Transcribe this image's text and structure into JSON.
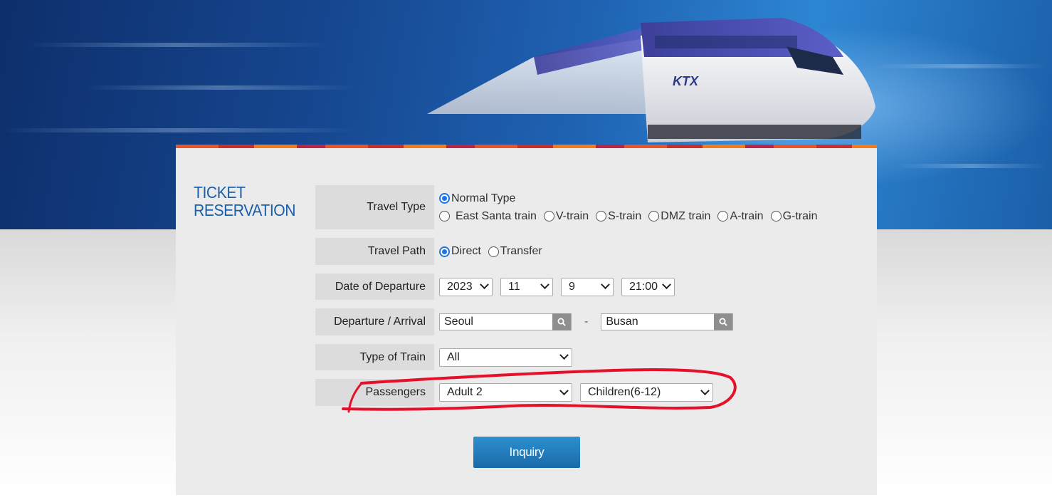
{
  "colors": {
    "accent_blue": "#1a5fa9",
    "button_blue": "#1a6aa8",
    "panel_bg": "#ebebeb",
    "label_bg": "#dcdcdc",
    "stripe_orange": "#e8552a",
    "annotation_red": "#e5102a"
  },
  "hero": {
    "train_logo": "KTX"
  },
  "section": {
    "title_line1": "TICKET",
    "title_line2": "RESERVATION"
  },
  "travel_type": {
    "label": "Travel Type",
    "options": [
      {
        "label": "Normal Type",
        "checked": true
      },
      {
        "label": "East Santa train",
        "checked": false
      },
      {
        "label": "V-train",
        "checked": false
      },
      {
        "label": "S-train",
        "checked": false
      },
      {
        "label": "DMZ train",
        "checked": false
      },
      {
        "label": "A-train",
        "checked": false
      },
      {
        "label": "G-train",
        "checked": false
      }
    ]
  },
  "travel_path": {
    "label": "Travel Path",
    "options": [
      {
        "label": "Direct",
        "checked": true
      },
      {
        "label": "Transfer",
        "checked": false
      }
    ]
  },
  "date": {
    "label": "Date of Departure",
    "year": "2023",
    "month": "11",
    "day": "9",
    "time": "21:00"
  },
  "route": {
    "label": "Departure / Arrival",
    "departure": "Seoul",
    "separator": "-",
    "arrival": "Busan",
    "search_icon": "magnifier-icon"
  },
  "train_type": {
    "label": "Type of Train",
    "selected": "All"
  },
  "passengers": {
    "label": "Passengers",
    "adult": "Adult 2",
    "children": "Children(6-12)"
  },
  "inquiry_button": {
    "label": "Inquiry"
  }
}
